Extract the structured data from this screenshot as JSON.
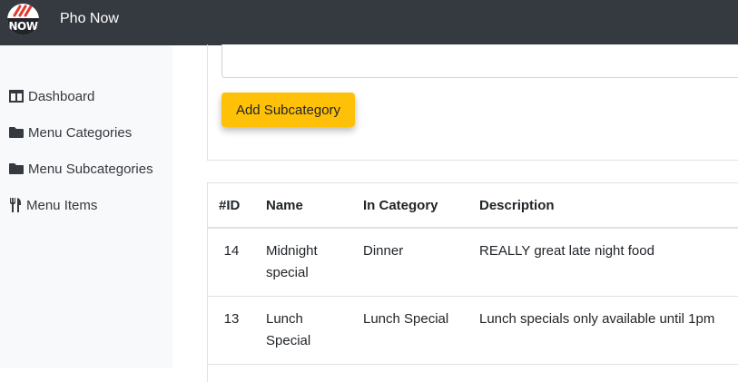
{
  "app": {
    "brand": "Pho Now",
    "logo_text": "NOW"
  },
  "sidebar": {
    "items": [
      {
        "label": "Dashboard",
        "icon": "table-columns-icon"
      },
      {
        "label": "Menu Categories",
        "icon": "folder-icon"
      },
      {
        "label": "Menu Subcategories",
        "icon": "folder-icon"
      },
      {
        "label": "Menu Items",
        "icon": "utensils-icon"
      }
    ]
  },
  "form": {
    "submit_label": "Add Subcategory"
  },
  "table": {
    "headers": [
      "#ID",
      "Name",
      "In Category",
      "Description"
    ],
    "rows": [
      {
        "id": "14",
        "name": "Midnight special",
        "category": "Dinner",
        "description": "REALLY great late night food"
      },
      {
        "id": "13",
        "name": "Lunch Special",
        "category": "Lunch Special",
        "description": "Lunch specials only available until 1pm"
      }
    ]
  },
  "colors": {
    "topbar": "#343a40",
    "sidebar": "#f8f9fa",
    "accent": "#ffc107",
    "logo_red": "#e03a2f"
  }
}
